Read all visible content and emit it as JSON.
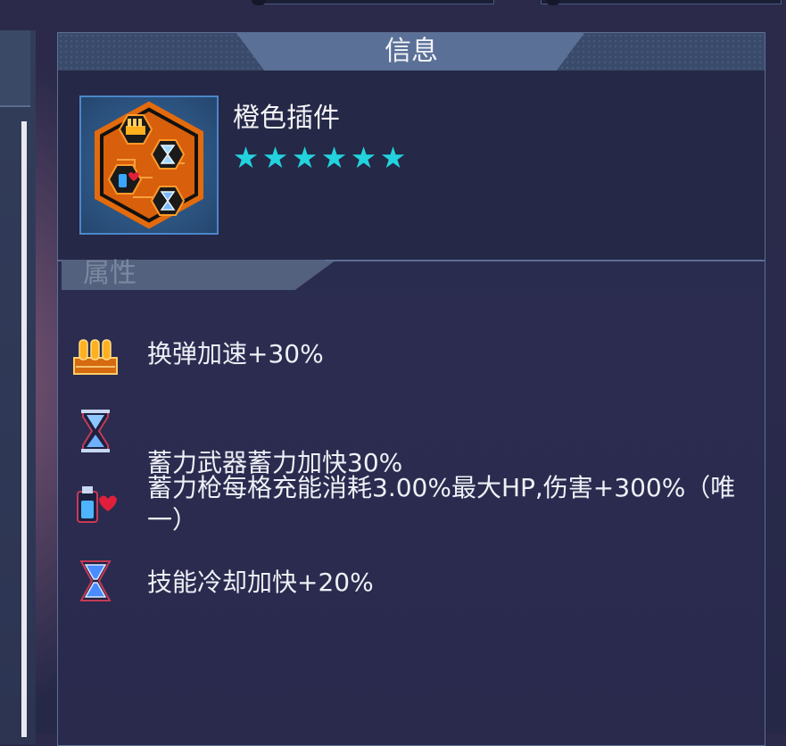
{
  "panel": {
    "title": "信息"
  },
  "item": {
    "name": "橙色插件",
    "star_count": 6,
    "star_glyph": "★",
    "frame_color": "#e36b0d",
    "star_color": "#22d3de"
  },
  "attributes": {
    "section_label": "属性",
    "rows": [
      {
        "icon": "ammo-clip-icon",
        "text": "换弹加速+30%"
      },
      {
        "icon": "hourglass-icon",
        "text": "蓄力武器蓄力加快30%"
      },
      {
        "icon": "potion-heart-icon",
        "text": "蓄力枪每格充能消耗3.00%最大HP,伤害+300%（唯一）"
      },
      {
        "icon": "hourglass-blue-icon",
        "text": "技能冷却加快+20%"
      }
    ]
  }
}
